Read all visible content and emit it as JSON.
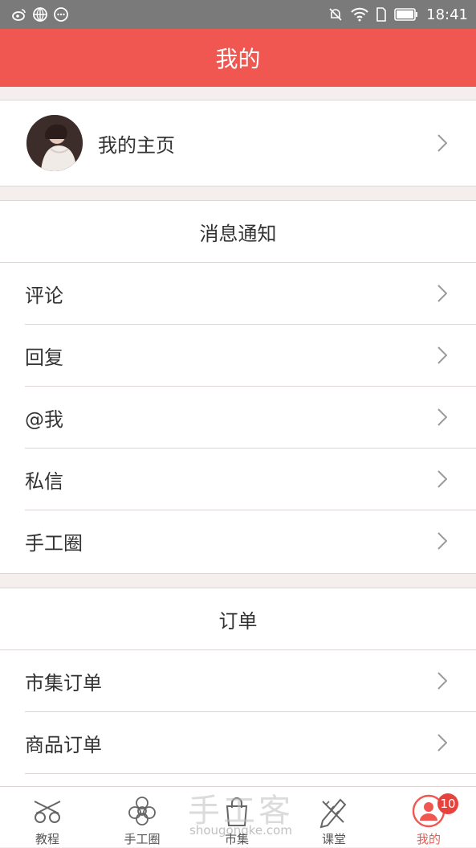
{
  "status_bar": {
    "time": "18:41",
    "left_icons": [
      "weibo-icon",
      "globe-icon",
      "more-icon"
    ],
    "right_icons": [
      "mute-icon",
      "wifi-icon",
      "sim-icon",
      "battery-icon"
    ]
  },
  "header": {
    "title": "我的"
  },
  "profile": {
    "label": "我的主页"
  },
  "notifications": {
    "header": "消息通知",
    "items": [
      {
        "label": "评论"
      },
      {
        "label": "回复"
      },
      {
        "label": "@我"
      },
      {
        "label": "私信"
      },
      {
        "label": "手工圈"
      }
    ]
  },
  "orders": {
    "header": "订单",
    "items": [
      {
        "label": "市集订单"
      },
      {
        "label": "商品订单"
      }
    ]
  },
  "tabbar": {
    "tabs": [
      {
        "label": "教程",
        "icon": "scissors-icon"
      },
      {
        "label": "手工圈",
        "icon": "flower-icon"
      },
      {
        "label": "市集",
        "icon": "bag-icon"
      },
      {
        "label": "课堂",
        "icon": "pencil-ruler-icon"
      },
      {
        "label": "我的",
        "icon": "user-icon",
        "badge": "10"
      }
    ],
    "active_color": "#ef5750"
  },
  "watermark": {
    "text": "手工客",
    "url": "shougongke.com"
  },
  "colors": {
    "accent": "#ef5750",
    "status_bar": "#7a7a7a",
    "background": "#f4efed"
  }
}
